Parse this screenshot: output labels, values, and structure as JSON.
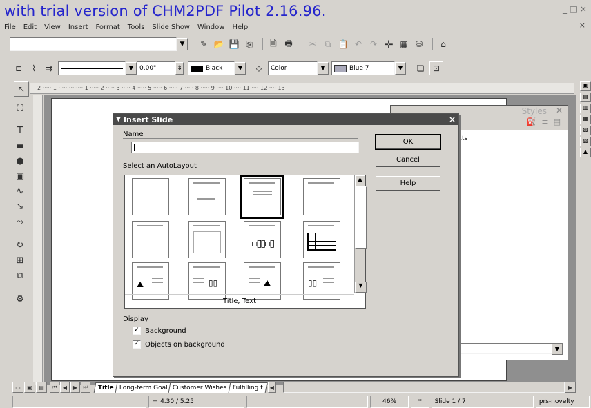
{
  "watermark": "with trial version of CHM2PDF Pilot 2.16.96.",
  "window_controls": "_ □ ×",
  "menu": [
    "File",
    "Edit",
    "View",
    "Insert",
    "Format",
    "Tools",
    "Slide Show",
    "Window",
    "Help"
  ],
  "doc_close": "×",
  "toolbar2": {
    "line_width": "0.00\"",
    "line_color": "Black",
    "area_style": "Color",
    "area_color": "Blue 7"
  },
  "ruler_text": "2 ····· 1 ·············· 1 ····· 2 ····· 3 ····· 4 ····· 5 ····· 6 ····· 7 ····· 8 ····· 9 ···· 10 ···· 11 ···· 12 ···· 13",
  "styles_panel": {
    "title": "Styles",
    "item_text": "cts"
  },
  "dialog": {
    "title": "Insert Slide",
    "name_label": "Name",
    "name_value": "",
    "autolayout_label": "Select an AutoLayout",
    "selected_layout": "Title, Text",
    "display_label": "Display",
    "checkbox_background": "Background",
    "checkbox_objects": "Objects on background",
    "ok": "OK",
    "cancel": "Cancel",
    "help": "Help",
    "close": "×"
  },
  "slide_tabs": [
    "Title",
    "Long-term Goal",
    "Customer Wishes",
    "Fulfilling t"
  ],
  "status": {
    "position": "4.30 / 5.25",
    "zoom": "46%",
    "slide": "Slide 1 / 7",
    "layout": "prs-novelty"
  },
  "colors": {
    "titlebar": "#4a4a4a",
    "watermark": "#2525cc",
    "workspace": "#8f8f8f"
  }
}
